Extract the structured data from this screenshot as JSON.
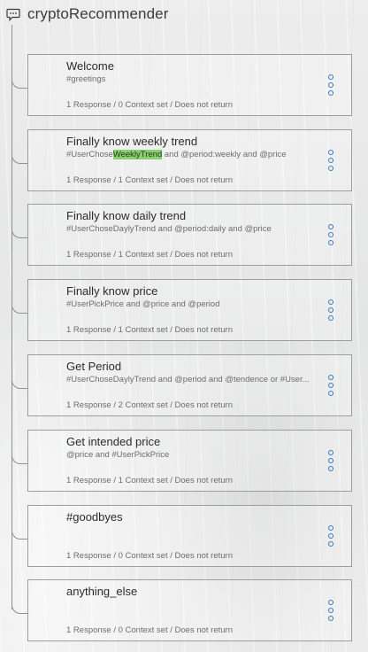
{
  "header": {
    "icon": "chat-bubble-icon",
    "title": "cryptoRecommender"
  },
  "nodes": [
    {
      "name": "Welcome",
      "cond_pre": "#greetings",
      "cond_hl": "",
      "cond_post": "",
      "meta": "1 Response / 0 Context set / Does not return"
    },
    {
      "name": "Finally know weekly trend",
      "cond_pre": "#UserChose",
      "cond_hl": "WeeklyTrend",
      "cond_post": " and @period:weekly and @price",
      "meta": "1 Response / 1 Context set / Does not return"
    },
    {
      "name": "Finally know daily trend",
      "cond_pre": "#UserChoseDaylyTrend and @period:daily and @price",
      "cond_hl": "",
      "cond_post": "",
      "meta": "1 Response / 1 Context set / Does not return"
    },
    {
      "name": "Finally know price",
      "cond_pre": "#UserPickPrice and @price and @period",
      "cond_hl": "",
      "cond_post": "",
      "meta": "1 Response / 1 Context set / Does not return"
    },
    {
      "name": "Get Period",
      "cond_pre": "#UserChoseDaylyTrend and @period and @tendence or #User...",
      "cond_hl": "",
      "cond_post": "",
      "meta": "1 Response / 2 Context set / Does not return"
    },
    {
      "name": "Get intended price",
      "cond_pre": "@price and #UserPickPrice",
      "cond_hl": "",
      "cond_post": "",
      "meta": "1 Response / 1 Context set / Does not return"
    },
    {
      "name": "#goodbyes",
      "cond_pre": "",
      "cond_hl": "",
      "cond_post": "",
      "meta": "1 Response / 0 Context set / Does not return"
    },
    {
      "name": "anything_else",
      "cond_pre": "",
      "cond_hl": "",
      "cond_post": "",
      "meta": "1 Response / 0 Context set / Does not return"
    }
  ],
  "colors": {
    "accent": "#3a7bbf",
    "highlight": "#8ccf70"
  }
}
